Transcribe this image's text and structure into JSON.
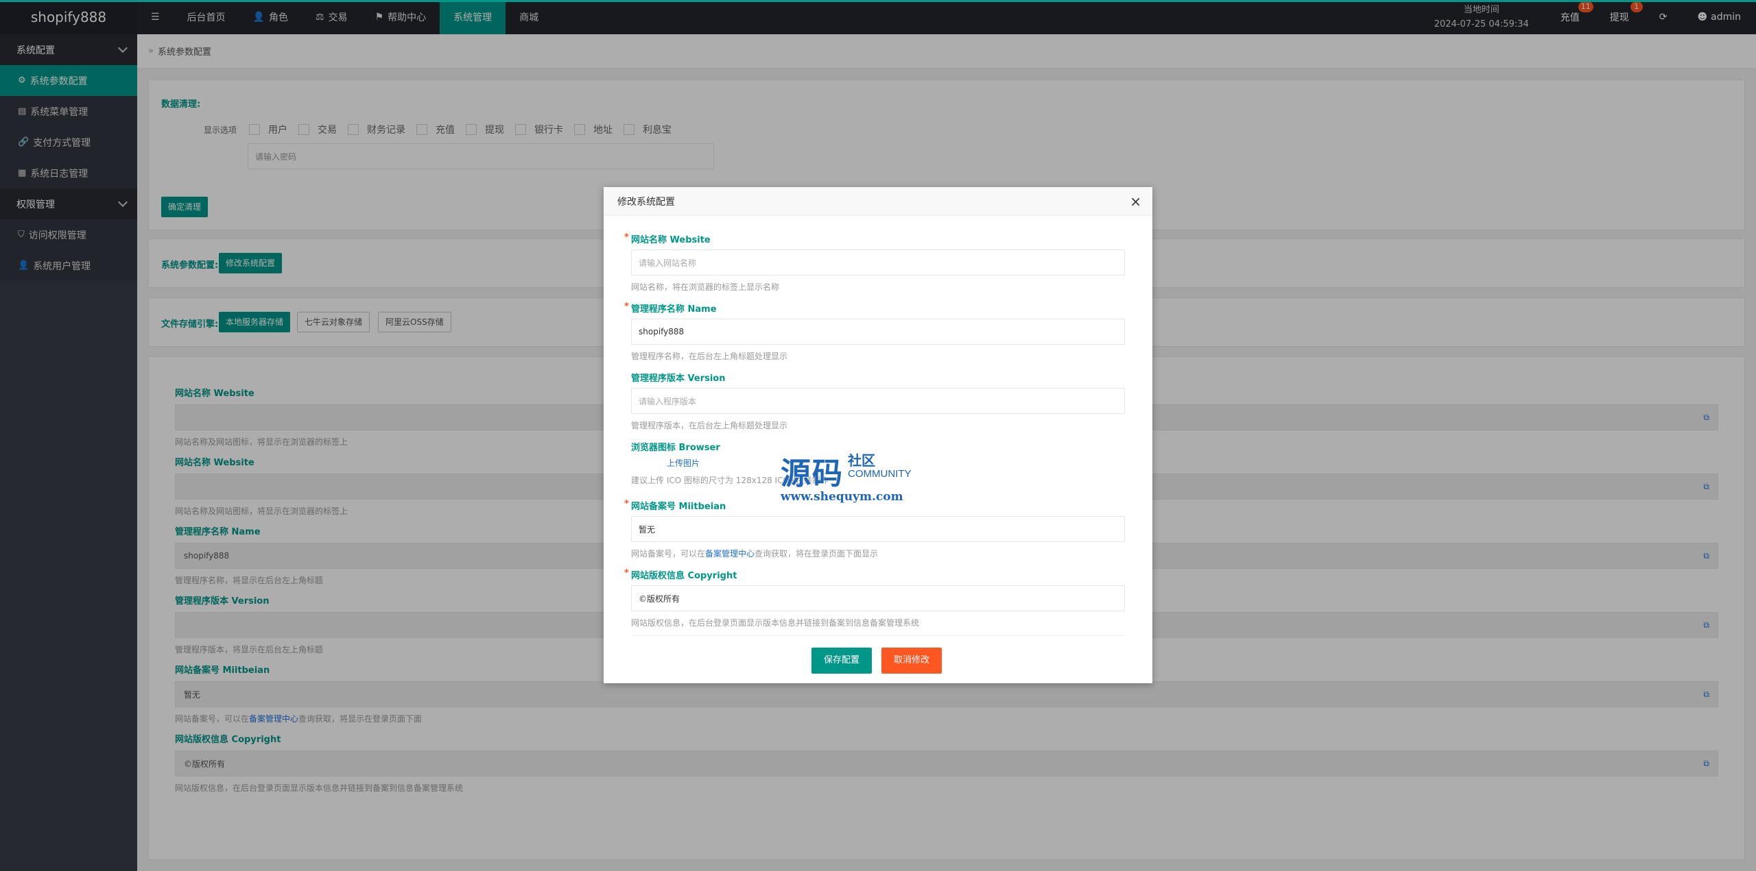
{
  "header": {
    "logo": "shopify888",
    "menu_icon": "☰",
    "nav": [
      {
        "label": "后台首页",
        "icon": ""
      },
      {
        "label": "角色",
        "icon": "👤"
      },
      {
        "label": "交易",
        "icon": "⚖"
      },
      {
        "label": "帮助中心",
        "icon": "⚑"
      },
      {
        "label": "系统管理",
        "icon": ""
      },
      {
        "label": "商城",
        "icon": ""
      }
    ],
    "clock_label": "当地时间",
    "clock_value": "2024-07-25 04:59:34",
    "recharge": "充值",
    "recharge_badge": "11",
    "withdraw": "提现",
    "withdraw_badge": "1",
    "refresh_icon": "⟳",
    "user": "admin"
  },
  "sidebar": {
    "group1": "系统配置",
    "items1": [
      "系统参数配置",
      "系统菜单管理",
      "支付方式管理",
      "系统日志管理"
    ],
    "group2": "权限管理",
    "items2": [
      "访问权限管理",
      "系统用户管理"
    ]
  },
  "main": {
    "breadcrumb": "系统参数配置",
    "cleanup": {
      "title": "数据清理:",
      "options_label": "显示选项",
      "options": [
        "用户",
        "交易",
        "财务记录",
        "充值",
        "提现",
        "银行卡",
        "地址",
        "利息宝"
      ],
      "password_placeholder": "请输入密码",
      "confirm_button": "确定清理"
    },
    "config": {
      "label": "系统参数配置:",
      "button": "修改系统配置"
    },
    "storage": {
      "label": "文件存储引擎:",
      "buttons": [
        "本地服务器存储",
        "七牛云对象存储",
        "阿里云OSS存储"
      ]
    },
    "fields": [
      {
        "label": "网站名称 Website",
        "value": "",
        "help": "网站名称及网站图标，将显示在浏览器的标签上"
      },
      {
        "label": "网站名称 Website",
        "value": "",
        "help": "网站名称及网站图标，将显示在浏览器的标签上"
      },
      {
        "label": "管理程序名称 Name",
        "value": "shopify888",
        "help": "管理程序名称，将显示在后台左上角标题"
      },
      {
        "label": "管理程序版本 Version",
        "value": "",
        "help": "管理程序版本，将显示在后台左上角标题"
      },
      {
        "label": "网站备案号 Miitbeian",
        "value": "暂无",
        "help_pre": "网站备案号，可以在",
        "help_link": "备案管理中心",
        "help_post": "查询获取，将显示在登录页面下面"
      },
      {
        "label": "网站版权信息 Copyright",
        "value": "©版权所有",
        "help": "网站版权信息，在后台登录页面显示版本信息并链接到备案到信息备案管理系统"
      }
    ]
  },
  "modal": {
    "title": "修改系统配置",
    "close": "×",
    "website_label": "网站名称 Website",
    "website_placeholder": "请输入网站名称",
    "website_help": "网站名称，将在浏览器的标签上显示名称",
    "name_label": "管理程序名称 Name",
    "name_value": "shopify888",
    "name_help": "管理程序名称，在后台左上角标题处理显示",
    "version_label": "管理程序版本 Version",
    "version_placeholder": "请输入程序版本",
    "version_help": "管理程序版本，在后台左上角标题处理显示",
    "browser_label": "浏览器图标 Browser",
    "upload": "上传图片",
    "browser_help": "建议上传 ICO 图标的尺寸为 128x128 ICON在线制作",
    "miit_label": "网站备案号 Miitbeian",
    "miit_value": "暂无",
    "miit_help_pre": "网站备案号，可以在",
    "miit_help_link": "备案管理中心",
    "miit_help_post": "查询获取，将在登录页面下面显示",
    "copyright_label": "网站版权信息 Copyright",
    "copyright_value": "©版权所有",
    "copyright_help": "网站版权信息，在后台登录页面显示版本信息并链接到备案到信息备案管理系统",
    "save": "保存配置",
    "cancel": "取消修改",
    "req": "*"
  },
  "watermark": {
    "big": "源码",
    "small": "社区",
    "community": "COMMUNITY",
    "url": "www.shequym.com"
  },
  "colors": {
    "accent": "#009688",
    "danger": "#ff5722",
    "header": "#23262e",
    "sidebar": "#393d49"
  }
}
